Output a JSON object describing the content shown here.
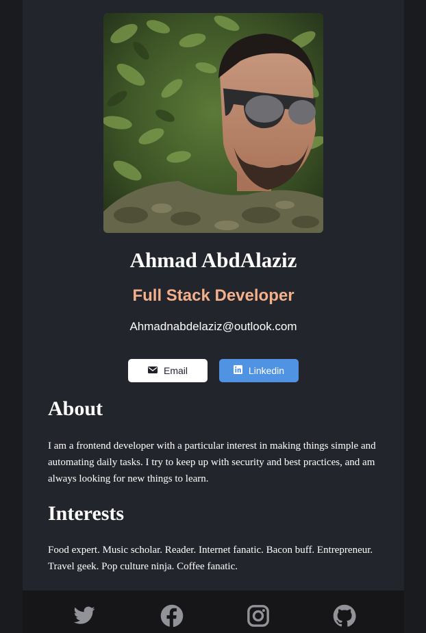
{
  "profile": {
    "name": "Ahmad AbdAlaziz",
    "role": "Full Stack Developer",
    "email": "Ahmadnabdelaziz@outlook.com"
  },
  "buttons": {
    "email_label": "Email",
    "linkedin_label": "Linkedin"
  },
  "about": {
    "heading": "About",
    "text": "I am a frontend developer with a particular interest in making things simple and automating daily tasks. I try to keep up with security and best practices, and am always looking for new things to learn."
  },
  "interests": {
    "heading": "Interests",
    "text": "Food expert. Music scholar. Reader. Internet fanatic. Bacon buff. Entrepreneur. Travel geek. Pop culture ninja. Coffee fanatic."
  },
  "footer": {
    "icons": [
      "twitter-icon",
      "facebook-icon",
      "instagram-icon",
      "github-icon"
    ]
  },
  "colors": {
    "page_bg": "#23252c",
    "outer_bg": "#1a1b1e",
    "footer_bg": "#161619",
    "accent": "#f3b08a",
    "linkedin_blue": "#5093e2",
    "icon_gray": "#919398"
  }
}
